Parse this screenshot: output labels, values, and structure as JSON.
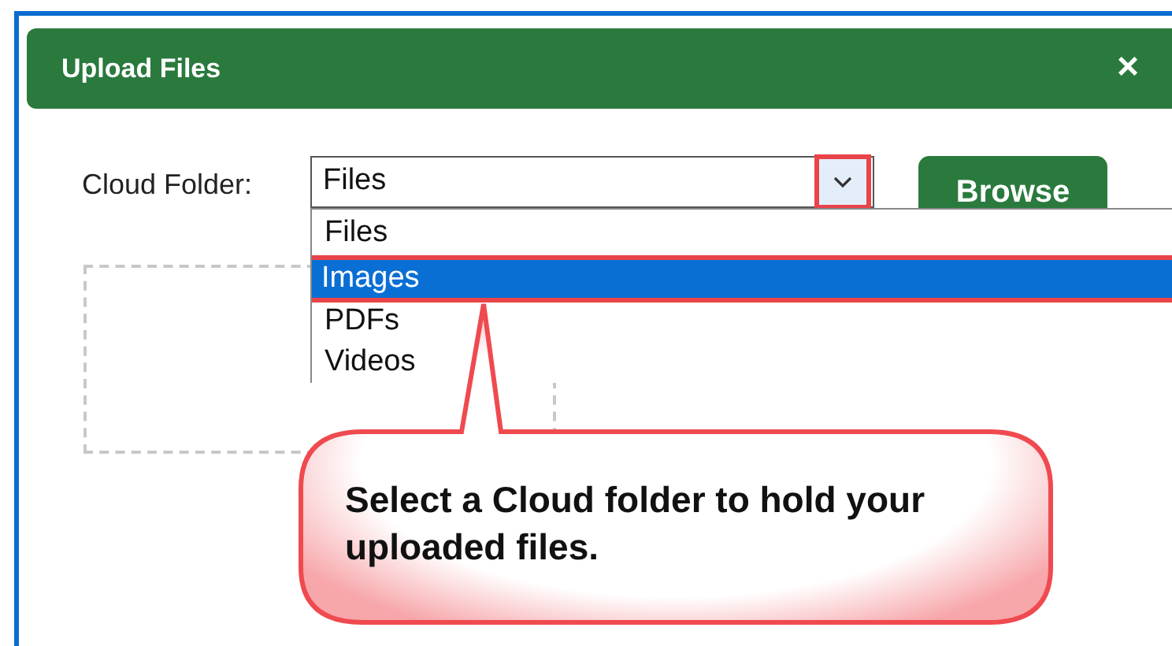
{
  "dialog": {
    "title": "Upload Files",
    "close": "×"
  },
  "cloud_folder": {
    "label": "Cloud Folder:",
    "value": "Files",
    "options": [
      {
        "label": "Files",
        "highlighted": false
      },
      {
        "label": "Images",
        "highlighted": true
      },
      {
        "label": "PDFs",
        "highlighted": false
      },
      {
        "label": "Videos",
        "highlighted": false
      }
    ]
  },
  "browse_button": "Browse",
  "callout": "Select a Cloud folder to hold your uploaded files."
}
